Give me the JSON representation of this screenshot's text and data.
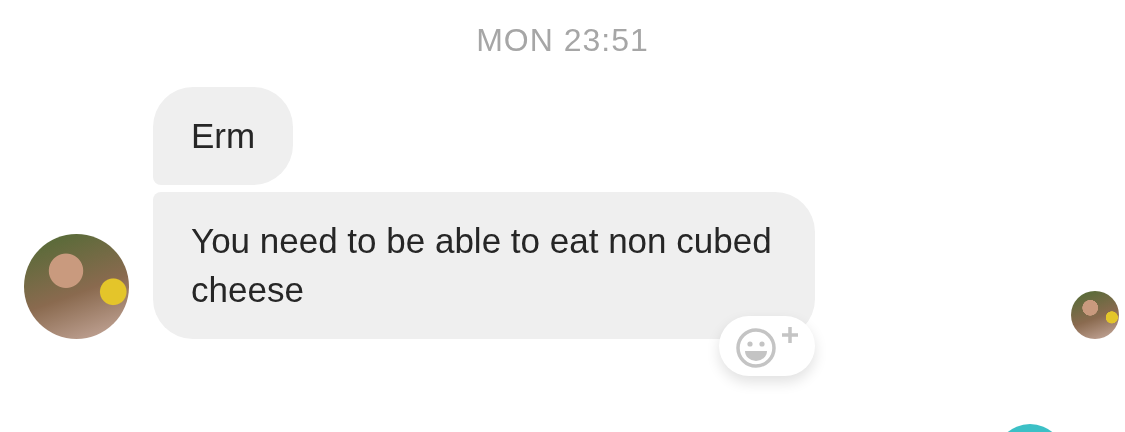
{
  "timestamp": "MON 23:51",
  "messages": [
    {
      "text": "Erm"
    },
    {
      "text": "You need to be able to eat non cubed cheese"
    }
  ]
}
